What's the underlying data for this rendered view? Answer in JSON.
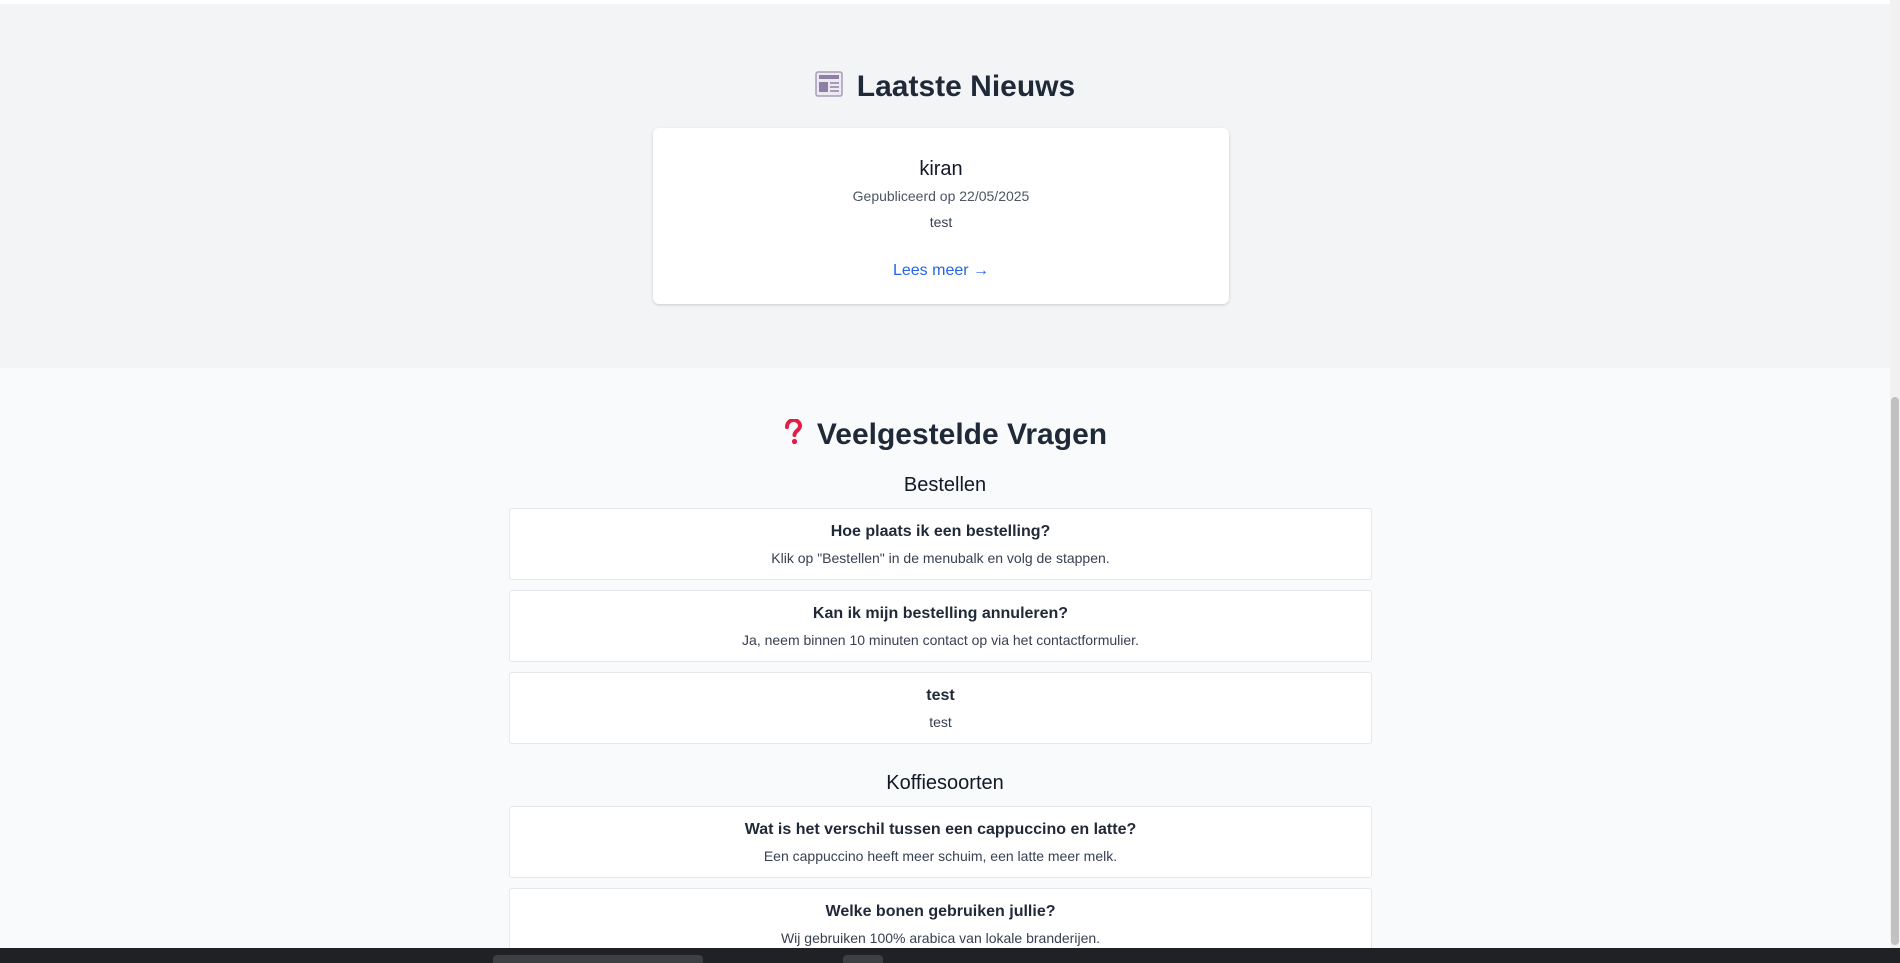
{
  "news": {
    "title": "Laatste Nieuws",
    "icon": "newspaper-icon",
    "article": {
      "title": "kiran",
      "date": "Gepubliceerd op 22/05/2025",
      "body": "test",
      "link": "Lees meer →"
    }
  },
  "faq": {
    "title": "Veelgestelde Vragen",
    "icon": "question-icon",
    "categories": [
      {
        "name": "Bestellen",
        "items": [
          {
            "q": "Hoe plaats ik een bestelling?",
            "a": "Klik op \"Bestellen\" in de menubalk en volg de stappen."
          },
          {
            "q": "Kan ik mijn bestelling annuleren?",
            "a": "Ja, neem binnen 10 minuten contact op via het contactformulier."
          },
          {
            "q": "test",
            "a": "test"
          }
        ]
      },
      {
        "name": "Koffiesoorten",
        "items": [
          {
            "q": "Wat is het verschil tussen een cappuccino en latte?",
            "a": "Een cappuccino heeft meer schuim, een latte meer melk."
          },
          {
            "q": "Welke bonen gebruiken jullie?",
            "a": "Wij gebruiken 100% arabica van lokale branderijen."
          }
        ]
      }
    ]
  },
  "colors": {
    "news_bg": "#f3f4f6",
    "faq_bg": "#f9fafb",
    "link": "#2563eb",
    "question_icon": "#e11d48"
  }
}
